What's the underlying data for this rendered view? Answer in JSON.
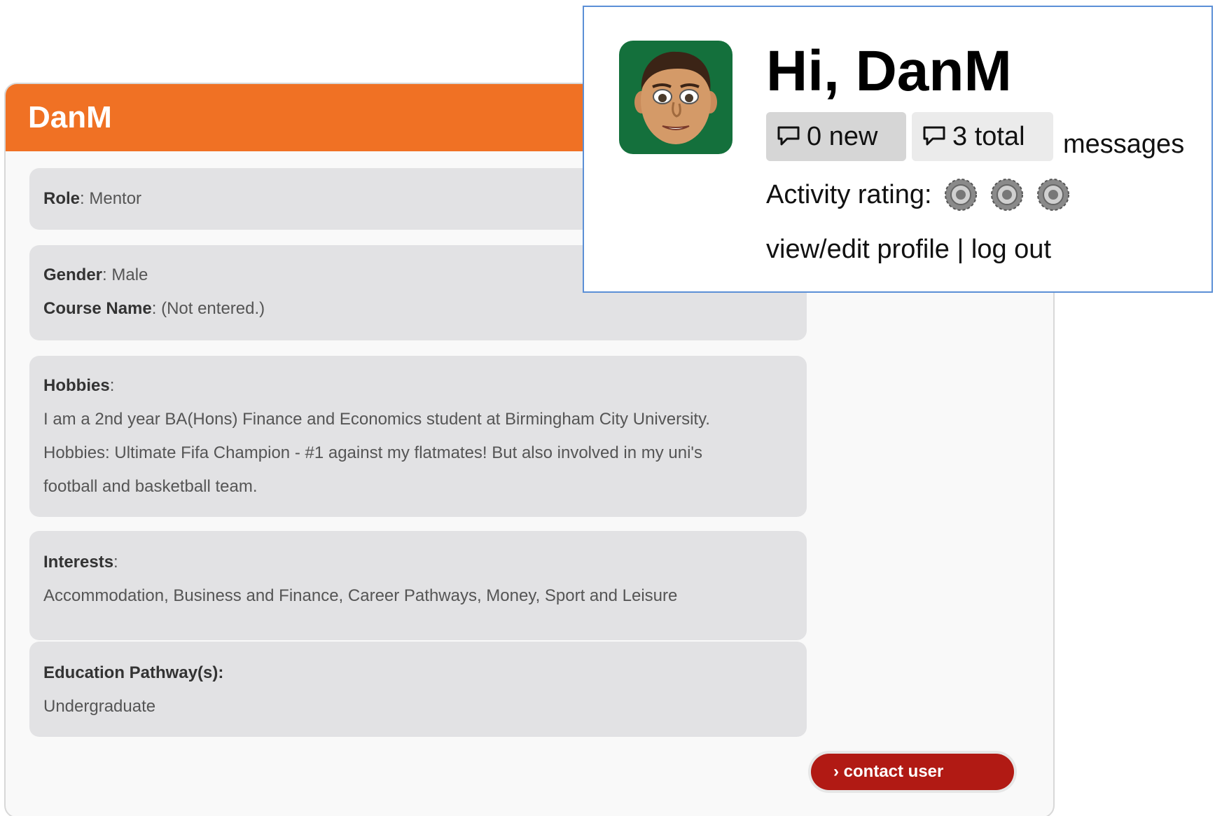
{
  "profile": {
    "name": "DanM",
    "role_label": "Role",
    "role_value": ": Mentor",
    "gender_label": "Gender",
    "gender_value": ": Male",
    "course_label": "Course Name",
    "course_value": ": (Not entered.)",
    "hobbies_label": "Hobbies",
    "hobbies_colon": ":",
    "hobbies_lines": [
      "I am a 2nd year BA(Hons) Finance and Economics student at Birmingham City University.",
      "Hobbies: Ultimate Fifa Champion - #1 against my flatmates! But also involved in my uni's",
      "football and basketball team."
    ],
    "interests_label": "Interests",
    "interests_colon": ":",
    "interests_value": "Accommodation, Business and Finance, Career Pathways, Money, Sport and Leisure",
    "education_label": "Education Pathway(s):",
    "education_value": "Undergraduate",
    "contact_button": "› contact user"
  },
  "account": {
    "greeting": "Hi, DanM",
    "new_messages": "0 new",
    "total_messages": "3 total",
    "messages_label": "messages",
    "activity_label": "Activity rating:",
    "rating_count": 3,
    "view_edit_link": "view/edit profile",
    "separator": " | ",
    "logout_link": "log out"
  },
  "colors": {
    "header_orange": "#f07124",
    "button_red": "#b11a14",
    "panel_border": "#5b8fd6",
    "info_box_bg": "#e2e2e4",
    "avatar_bg": "#14703c"
  }
}
